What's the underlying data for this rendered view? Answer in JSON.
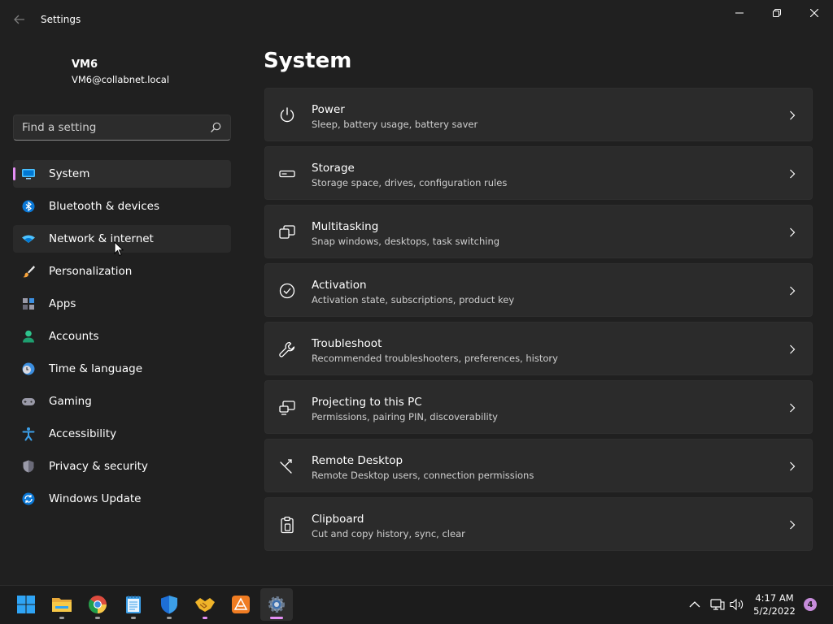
{
  "window": {
    "title": "Settings"
  },
  "profile": {
    "name": "VM6",
    "email": "VM6@collabnet.local"
  },
  "search": {
    "placeholder": "Find a setting"
  },
  "sidebar": {
    "items": [
      {
        "label": "System",
        "icon": "system-icon",
        "selected": true
      },
      {
        "label": "Bluetooth & devices",
        "icon": "bluetooth-icon"
      },
      {
        "label": "Network & internet",
        "icon": "wifi-icon"
      },
      {
        "label": "Personalization",
        "icon": "brush-icon"
      },
      {
        "label": "Apps",
        "icon": "apps-icon"
      },
      {
        "label": "Accounts",
        "icon": "person-icon"
      },
      {
        "label": "Time & language",
        "icon": "clock-globe-icon"
      },
      {
        "label": "Gaming",
        "icon": "gamepad-icon"
      },
      {
        "label": "Accessibility",
        "icon": "accessibility-icon"
      },
      {
        "label": "Privacy & security",
        "icon": "shield-icon"
      },
      {
        "label": "Windows Update",
        "icon": "update-icon"
      }
    ]
  },
  "main": {
    "title": "System",
    "cards": [
      {
        "title": "Power",
        "subtitle": "Sleep, battery usage, battery saver",
        "icon": "power-icon"
      },
      {
        "title": "Storage",
        "subtitle": "Storage space, drives, configuration rules",
        "icon": "storage-icon"
      },
      {
        "title": "Multitasking",
        "subtitle": "Snap windows, desktops, task switching",
        "icon": "multitasking-icon"
      },
      {
        "title": "Activation",
        "subtitle": "Activation state, subscriptions, product key",
        "icon": "activation-icon"
      },
      {
        "title": "Troubleshoot",
        "subtitle": "Recommended troubleshooters, preferences, history",
        "icon": "wrench-icon"
      },
      {
        "title": "Projecting to this PC",
        "subtitle": "Permissions, pairing PIN, discoverability",
        "icon": "projecting-icon"
      },
      {
        "title": "Remote Desktop",
        "subtitle": "Remote Desktop users, connection permissions",
        "icon": "remote-desktop-icon"
      },
      {
        "title": "Clipboard",
        "subtitle": "Cut and copy history, sync, clear",
        "icon": "clipboard-icon"
      }
    ]
  },
  "taskbar": {
    "apps": [
      "windows-start-icon",
      "file-explorer-icon",
      "chrome-icon",
      "notepad-icon",
      "defender-shield-icon",
      "handshake-icon",
      "app-icon",
      "settings-gear-icon"
    ],
    "clock": {
      "time": "4:17 AM",
      "date": "5/2/2022"
    },
    "notifications": "4"
  },
  "colors": {
    "accent": "#e58ff5",
    "background": "#202020",
    "card": "#2b2b2b"
  }
}
